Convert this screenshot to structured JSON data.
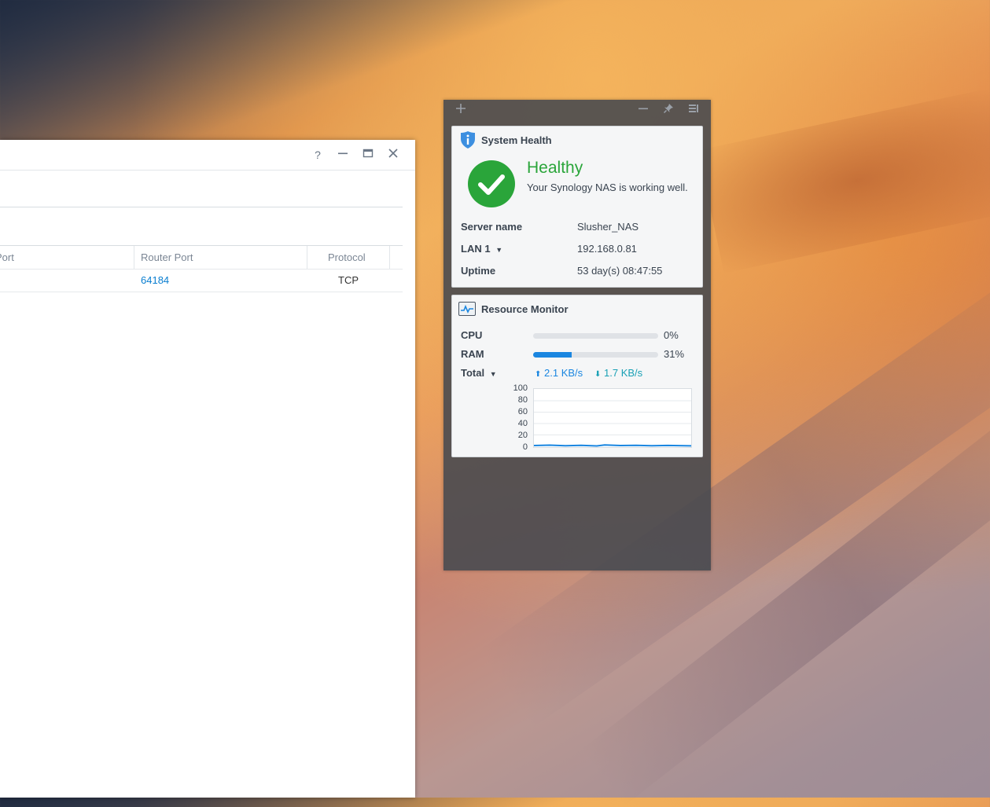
{
  "window": {
    "controls": [
      "help-icon",
      "minimize-icon",
      "maximize-icon",
      "close-icon"
    ],
    "help_glyph": "?",
    "grid": {
      "columns": [
        "Port",
        "Router Port",
        "Protocol"
      ],
      "rows": [
        {
          "port": "",
          "router_port": "64184",
          "protocol": "TCP"
        }
      ]
    }
  },
  "widgets": {
    "toolbar_icons": [
      "add-icon",
      "minimize-icon",
      "pin-icon",
      "layout-icon"
    ],
    "system_health": {
      "title": "System Health",
      "status": "Healthy",
      "message": "Your Synology NAS is working well.",
      "status_color": "#2aa53a",
      "fields": [
        {
          "key": "Server name",
          "value": "Slusher_NAS"
        },
        {
          "key": "LAN 1",
          "value": "192.168.0.81"
        },
        {
          "key": "Uptime",
          "value": "53 day(s) 08:47:55"
        }
      ]
    },
    "resource_monitor": {
      "title": "Resource Monitor",
      "cpu_label": "CPU",
      "cpu_value": "0%",
      "cpu_fraction": 0.0,
      "ram_label": "RAM",
      "ram_value": "31%",
      "ram_fraction": 0.31,
      "total_label": "Total",
      "upload": "2.1 KB/s",
      "download": "1.7 KB/s",
      "accent": "#1a86e0",
      "download_color": "#19a0b5",
      "chart_ticks": [
        "100",
        "80",
        "60",
        "40",
        "20",
        "0"
      ]
    }
  }
}
